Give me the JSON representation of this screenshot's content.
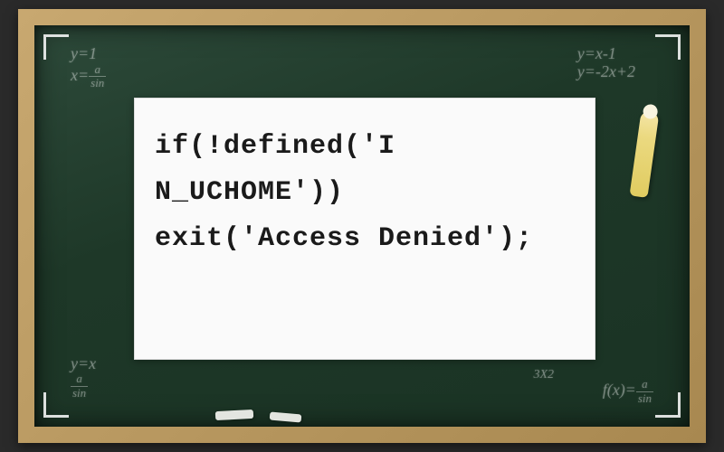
{
  "paper": {
    "line1": "if(!defined('I",
    "line2": "N_UCHOME'))",
    "line3": "exit('Access Denied');"
  },
  "decorations": {
    "tl_line1": "y=1",
    "tl_line2": "x=",
    "tr_line1": "y=x-1",
    "tr_line2": "y=-2x+2",
    "bl_line1": "y=x",
    "bl_line2": "sin",
    "br_line1": "f(x)=",
    "br_line2": "sin",
    "br2": "3X2"
  },
  "frac": {
    "num": "a",
    "den": "sin"
  }
}
